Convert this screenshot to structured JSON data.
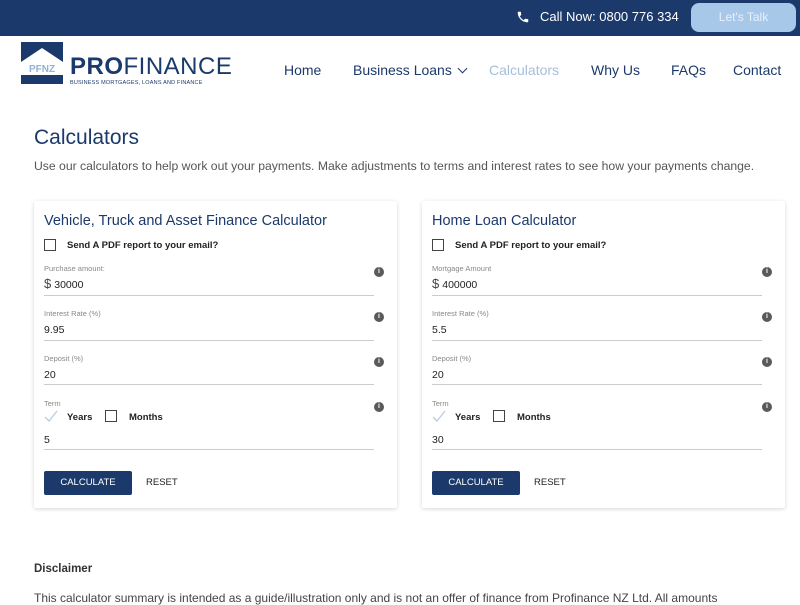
{
  "topbar": {
    "phone_icon": "phone-icon",
    "call_text": "Call Now: 0800 776 334",
    "cta_label": "Let's Talk"
  },
  "logo": {
    "badge": "PFNZ",
    "brand_bold": "PRO",
    "brand_light": "FINANCE",
    "tagline": "BUSINESS MORTGAGES, LOANS AND FINANCE"
  },
  "nav": {
    "items": [
      {
        "label": "Home"
      },
      {
        "label": "Business Loans",
        "has_dropdown": true
      },
      {
        "label": "Calculators",
        "active": true
      },
      {
        "label": "Why Us"
      },
      {
        "label": "FAQs"
      },
      {
        "label": "Contact"
      }
    ]
  },
  "page": {
    "title": "Calculators",
    "intro": "Use our calculators to help work out your payments. Make adjustments to terms and interest rates to see how your payments change."
  },
  "calculators": [
    {
      "title": "Vehicle, Truck and Asset Finance Calculator",
      "pdf_label": "Send A PDF report to your email?",
      "pdf_checked": false,
      "fields": [
        {
          "label": "Purchase amount:",
          "currency": "$",
          "value": "30000"
        },
        {
          "label": "Interest Rate (%)",
          "value": "9.95"
        },
        {
          "label": "Deposit (%)",
          "value": "20"
        }
      ],
      "term": {
        "label": "Term",
        "years_label": "Years",
        "years_checked": true,
        "months_label": "Months",
        "months_checked": false,
        "value": "5"
      },
      "calculate_label": "CALCULATE",
      "reset_label": "RESET"
    },
    {
      "title": "Home Loan Calculator",
      "pdf_label": "Send A PDF report to your email?",
      "pdf_checked": false,
      "fields": [
        {
          "label": "Mortgage Amount",
          "currency": "$",
          "value": "400000"
        },
        {
          "label": "Interest Rate (%)",
          "value": "5.5"
        },
        {
          "label": "Deposit (%)",
          "value": "20"
        }
      ],
      "term": {
        "label": "Term",
        "years_label": "Years",
        "years_checked": true,
        "months_label": "Months",
        "months_checked": false,
        "value": "30"
      },
      "calculate_label": "CALCULATE",
      "reset_label": "RESET"
    }
  ],
  "disclaimer": {
    "title": "Disclaimer",
    "text": "This calculator summary is intended as a guide/illustration only and is not an offer of finance from Profinance NZ Ltd. All amounts"
  },
  "colors": {
    "brand_navy": "#1b3a6b",
    "active_nav": "#a3bfdc",
    "cta_bg": "#a8c8ea"
  }
}
